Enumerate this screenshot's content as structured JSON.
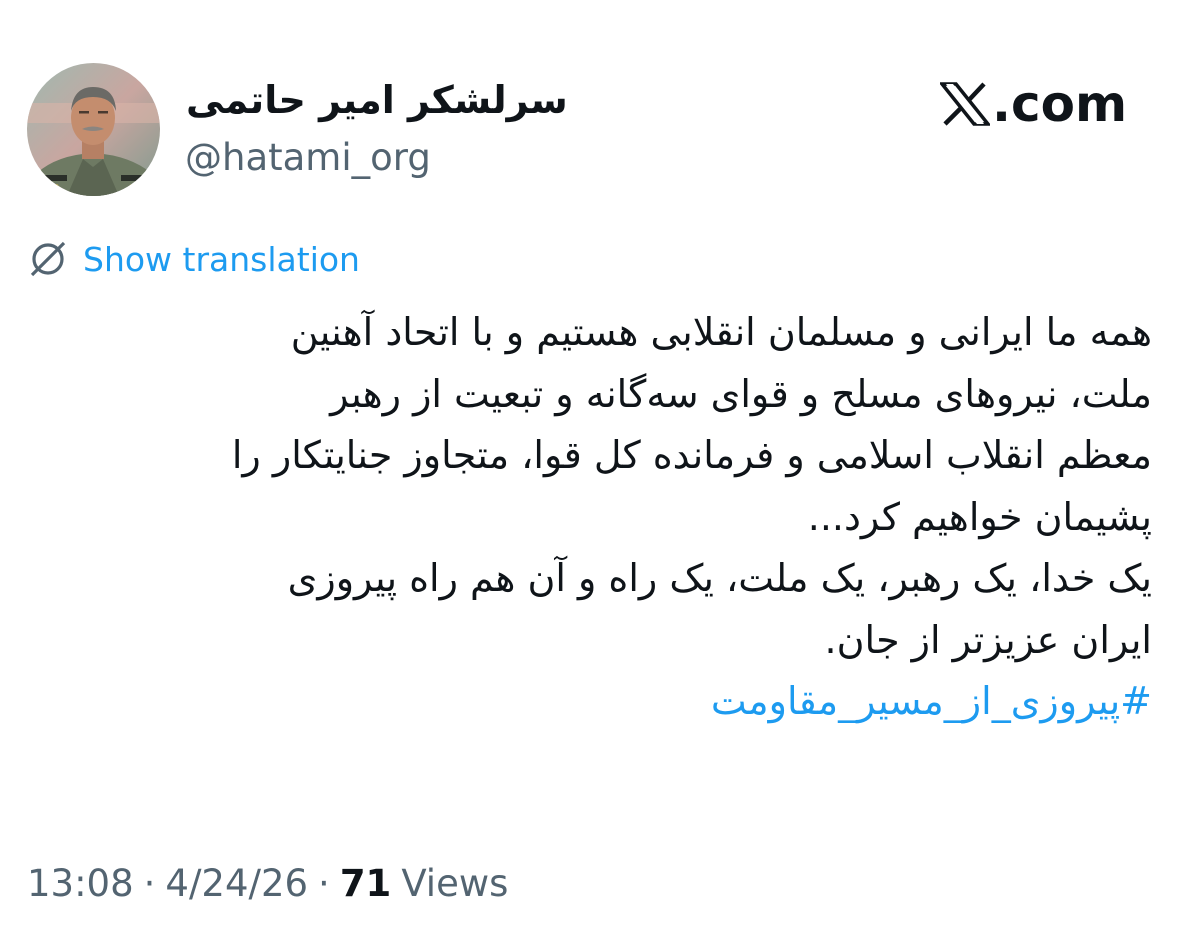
{
  "profile": {
    "display_name": "سرلشکر امیر حاتمی",
    "handle": "@hatami_org",
    "avatar_icon": "profile-photo"
  },
  "site": {
    "logo_icon": "x-logo-icon",
    "name_suffix": ".com"
  },
  "translation": {
    "icon": "globe-icon",
    "label": "Show translation"
  },
  "tweet": {
    "lines": [
      "همه ما ایرانی و مسلمان انقلابی هستیم و با اتحاد آهنین",
      "ملت، نیروهای مسلح و قوای سه‌گانه و تبعیت از رهبر",
      "معظم انقلاب اسلامی و فرمانده کل قوا، متجاوز جنایتکار را",
      "پشیمان خواهیم کرد...",
      "یک خدا، یک رهبر، یک ملت، یک راه و آن هم راه پیروزی",
      "ایران عزیزتر از جان."
    ],
    "hashtag": "#پیروزی_از_مسیر_مقاومت"
  },
  "meta": {
    "time": "13:08",
    "separator": "·",
    "date": "4/24/26",
    "views_count": "71",
    "views_label": "Views"
  },
  "colors": {
    "link": "#1d9bf0",
    "secondary_text": "#536471",
    "primary_text": "#0f1419"
  }
}
